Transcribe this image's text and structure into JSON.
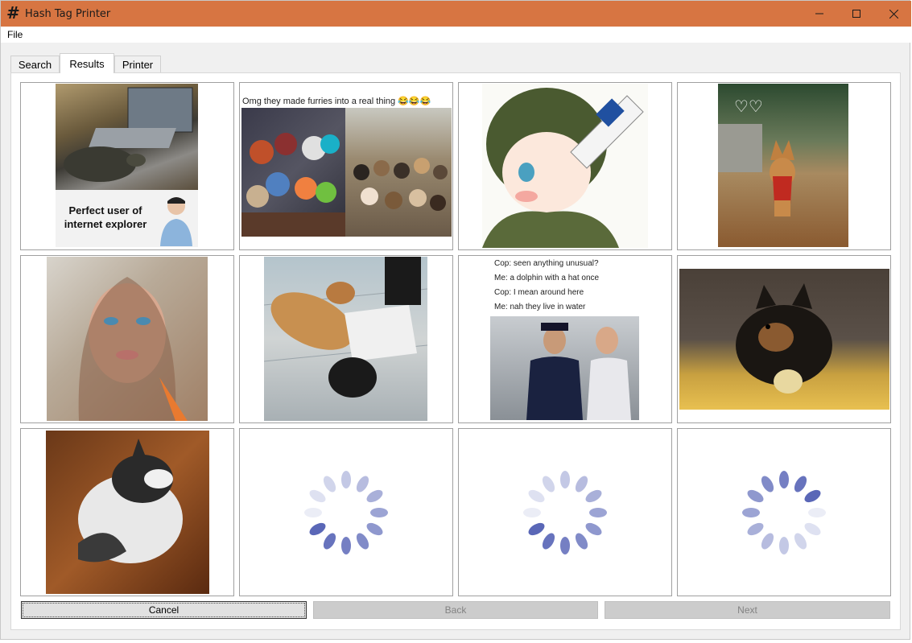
{
  "window": {
    "title": "Hash Tag Printer",
    "app_icon": "hash-icon",
    "minimize": "—",
    "maximize": "□",
    "close": "✕"
  },
  "menu": {
    "file": "File"
  },
  "tabs": [
    {
      "label": "Search",
      "active": false
    },
    {
      "label": "Results",
      "active": true
    },
    {
      "label": "Printer",
      "active": false
    }
  ],
  "results": [
    {
      "kind": "meme",
      "caption": "Perfect user of internet explorer",
      "subject": "turtle on laptop"
    },
    {
      "kind": "meme",
      "caption": "Omg they made furries into a real thing 😂😂😂",
      "subject": "furries and dogs"
    },
    {
      "kind": "image",
      "subject": "anime soldier drinking bleach"
    },
    {
      "kind": "image",
      "subject": "small dog in autumn leaves"
    },
    {
      "kind": "image",
      "subject": "woman selfie"
    },
    {
      "kind": "image",
      "subject": "dog lying with person"
    },
    {
      "kind": "meme",
      "lines": [
        "Cop: seen anything unusual?",
        "Me: a dolphin with a hat once",
        "Cop: I mean around here",
        "Me: nah they live in water"
      ],
      "subject": "police officer"
    },
    {
      "kind": "image",
      "subject": "german shepherd puppy"
    },
    {
      "kind": "image",
      "subject": "husky in leaves"
    },
    {
      "kind": "loading"
    },
    {
      "kind": "loading"
    },
    {
      "kind": "loading"
    }
  ],
  "buttons": {
    "cancel": "Cancel",
    "back": "Back",
    "next": "Next"
  },
  "colors": {
    "titlebar": "#d77542",
    "spinner": "#5a67b7"
  }
}
